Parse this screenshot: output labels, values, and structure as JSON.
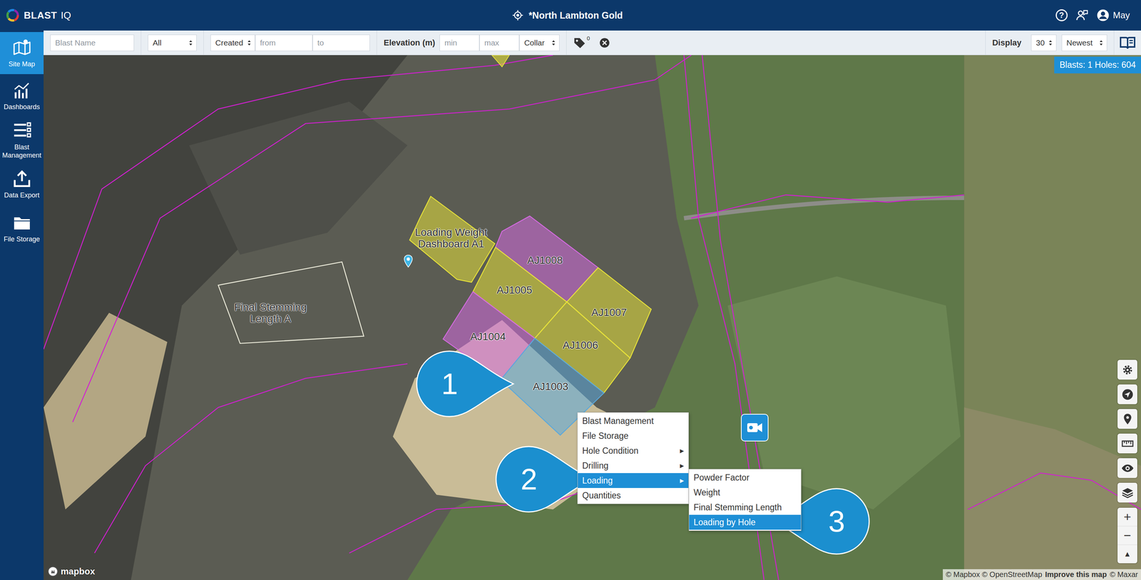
{
  "app": {
    "logo_main": "BLAST",
    "logo_suffix": "IQ",
    "site": "*North Lambton Gold",
    "help": "?",
    "user": "May"
  },
  "sidebar": {
    "items": [
      {
        "label": "Site Map",
        "selected": true
      },
      {
        "label": "Dashboards",
        "selected": false
      },
      {
        "label": "Blast Management",
        "selected": false
      },
      {
        "label": "Data Export",
        "selected": false
      },
      {
        "label": "File Storage",
        "selected": false
      }
    ]
  },
  "filters": {
    "blast_name": {
      "placeholder": "Blast Name"
    },
    "status": "All",
    "date_field": "Created",
    "date_from": {
      "placeholder": "from"
    },
    "date_to": {
      "placeholder": "to"
    },
    "elevation_label": "Elevation (m)",
    "elevation_min": {
      "placeholder": "min"
    },
    "elevation_max": {
      "placeholder": "max"
    },
    "elevation_ref": "Collar",
    "tag_count": "0",
    "display_label": "Display",
    "display_count": "30",
    "sort": "Newest"
  },
  "map": {
    "summary": "Blasts: 1 Holes: 604",
    "blasts": [
      {
        "label": "Loading Weight Dashboard A1",
        "color": "#e6e13a",
        "filled": true
      },
      {
        "label": "AJ1008",
        "color": "#d46be0",
        "filled": true
      },
      {
        "label": "AJ1005",
        "color": "#e6e13a",
        "filled": true
      },
      {
        "label": "AJ1007",
        "color": "#e6e13a",
        "filled": true
      },
      {
        "label": "AJ1004",
        "color": "#d46be0",
        "filled": true
      },
      {
        "label": "AJ1006",
        "color": "#e6e13a",
        "filled": true
      },
      {
        "label": "AJ1003",
        "color": "#5aa8dc",
        "filled": true
      },
      {
        "label": "Final Stemming Length A",
        "color": "#efeedd",
        "filled": false
      }
    ],
    "zoom_in": "+",
    "zoom_out": "−",
    "north": "▲",
    "logo": "mapbox",
    "attribution": {
      "credits": "© Mapbox © OpenStreetMap",
      "improve": "Improve this map",
      "imagery": "© Maxar"
    }
  },
  "context_menu": {
    "arrow": "▶",
    "items": [
      {
        "label": "Blast Management",
        "has_submenu": false,
        "selected": false
      },
      {
        "label": "File Storage",
        "has_submenu": false,
        "selected": false
      },
      {
        "label": "Hole Condition",
        "has_submenu": true,
        "selected": false
      },
      {
        "label": "Drilling",
        "has_submenu": true,
        "selected": false
      },
      {
        "label": "Loading",
        "has_submenu": true,
        "selected": true
      },
      {
        "label": "Quantities",
        "has_submenu": false,
        "selected": false
      }
    ],
    "submenu": [
      {
        "label": "Powder Factor",
        "selected": false
      },
      {
        "label": "Weight",
        "selected": false
      },
      {
        "label": "Final Stemming Length",
        "selected": false
      },
      {
        "label": "Loading by Hole",
        "selected": true
      }
    ]
  },
  "callouts": [
    {
      "number": "1",
      "kind": "right"
    },
    {
      "number": "2",
      "kind": "right"
    },
    {
      "number": "3",
      "kind": "left"
    }
  ]
}
